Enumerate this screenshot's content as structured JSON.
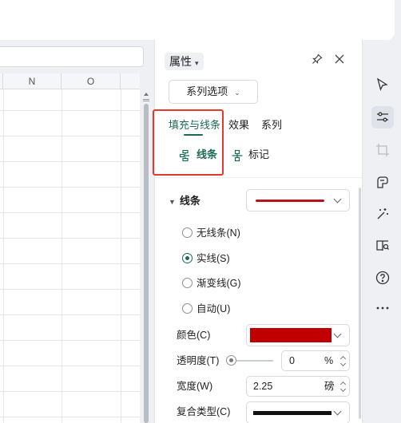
{
  "sheet": {
    "columns": [
      "N",
      "O"
    ]
  },
  "panel": {
    "title": "属性",
    "series_option": "系列选项",
    "tabs": [
      {
        "label": "填充与线条",
        "active": true
      },
      {
        "label": "效果",
        "active": false
      },
      {
        "label": "系列",
        "active": false
      }
    ],
    "subtabs": [
      {
        "label": "线条",
        "icon": "line-icon",
        "active": true
      },
      {
        "label": "标记",
        "icon": "marker-icon",
        "active": false
      }
    ],
    "line_section": {
      "title": "线条",
      "line_color": "#b5121b",
      "options": [
        {
          "label": "无线条(N)",
          "checked": false
        },
        {
          "label": "实线(S)",
          "checked": true
        },
        {
          "label": "渐变线(G)",
          "checked": false
        },
        {
          "label": "自动(U)",
          "checked": false
        }
      ],
      "color_label": "颜色(C)",
      "color_value": "#c00000",
      "transparency_label": "透明度(T)",
      "transparency_value": "0",
      "transparency_unit": "%",
      "width_label": "宽度(W)",
      "width_value": "2.25",
      "width_unit": "磅",
      "compound_label": "复合类型(C)"
    }
  },
  "right_bar": {
    "icons": [
      "cursor-icon",
      "properties-icon",
      "crop-icon",
      "style-icon",
      "magic-icon",
      "book-icon",
      "help-icon",
      "more-icon"
    ]
  },
  "colors": {
    "accent": "#1c6b55",
    "highlight": "#e23b2e"
  }
}
